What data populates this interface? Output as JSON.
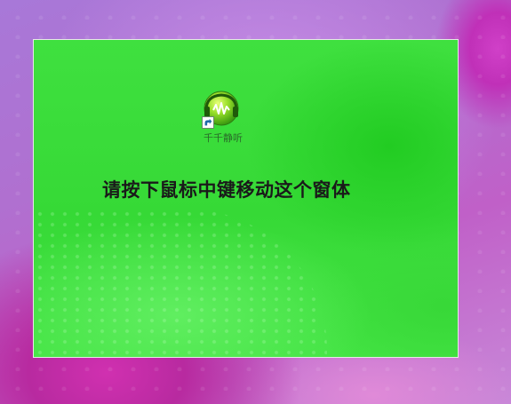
{
  "desktop": {
    "wallpaper_colors": [
      "#a878d8",
      "#c030b8",
      "#d040c8"
    ]
  },
  "window": {
    "background_color": "#3fe03f",
    "border_color": "#e8e8e8",
    "instruction_text": "请按下鼠标中键移动这个窗体",
    "desktop_icon": {
      "label": "千千静听",
      "icon": "music-player-icon",
      "overlay_icon": "shortcut-arrow-icon"
    }
  }
}
